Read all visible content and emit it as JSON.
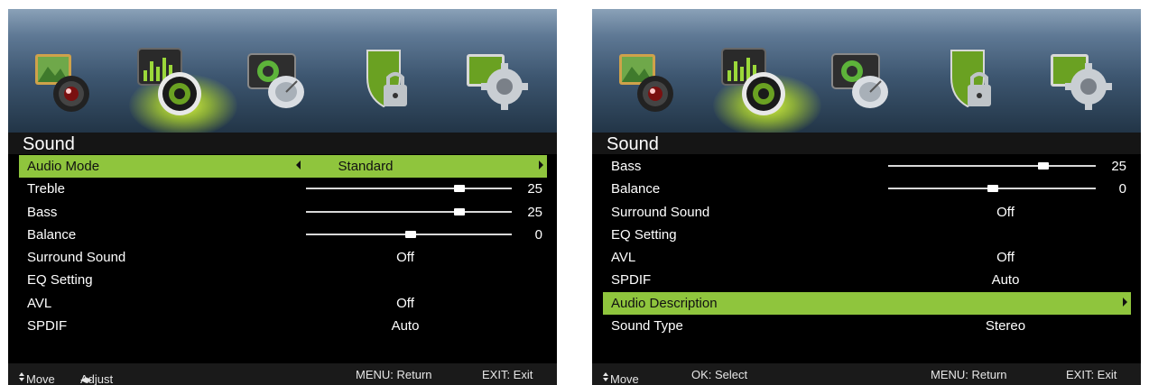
{
  "left_panel": {
    "title": "Sound",
    "audio_mode": {
      "label": "Audio Mode",
      "value": "Standard"
    },
    "treble": {
      "label": "Treble",
      "value": "25",
      "level": 25,
      "min": -25,
      "max": 25
    },
    "bass": {
      "label": "Bass",
      "value": "25",
      "level": 25,
      "min": -25,
      "max": 25
    },
    "balance": {
      "label": "Balance",
      "value": "0",
      "level": 0,
      "min": -25,
      "max": 25
    },
    "surround": {
      "label": "Surround Sound",
      "value": "Off"
    },
    "eq": {
      "label": "EQ Setting"
    },
    "avl": {
      "label": "AVL",
      "value": "Off"
    },
    "spdif": {
      "label": "SPDIF",
      "value": "Auto"
    },
    "footer": {
      "move": "Move",
      "adjust": "Adjust",
      "menu": "MENU: Return",
      "exit": "EXIT: Exit"
    }
  },
  "right_panel": {
    "title": "Sound",
    "bass": {
      "label": "Bass",
      "value": "25",
      "level": 25,
      "min": -25,
      "max": 25
    },
    "balance": {
      "label": "Balance",
      "value": "0",
      "level": 0,
      "min": -25,
      "max": 25
    },
    "surround": {
      "label": "Surround Sound",
      "value": "Off"
    },
    "eq": {
      "label": "EQ Setting"
    },
    "avl": {
      "label": "AVL",
      "value": "Off"
    },
    "spdif": {
      "label": "SPDIF",
      "value": "Auto"
    },
    "audio_description": {
      "label": "Audio Description"
    },
    "sound_type": {
      "label": "Sound Type",
      "value": "Stereo"
    },
    "footer": {
      "move": "Move",
      "select": "OK: Select",
      "menu": "MENU: Return",
      "exit": "EXIT: Exit"
    }
  },
  "icons": [
    "picture-icon",
    "sound-icon",
    "channel-icon",
    "lock-icon",
    "setup-icon"
  ],
  "colors": {
    "highlight": "#8fc53d",
    "background": "#000000",
    "text": "#ffffff",
    "glow": "#d9ff3a"
  }
}
